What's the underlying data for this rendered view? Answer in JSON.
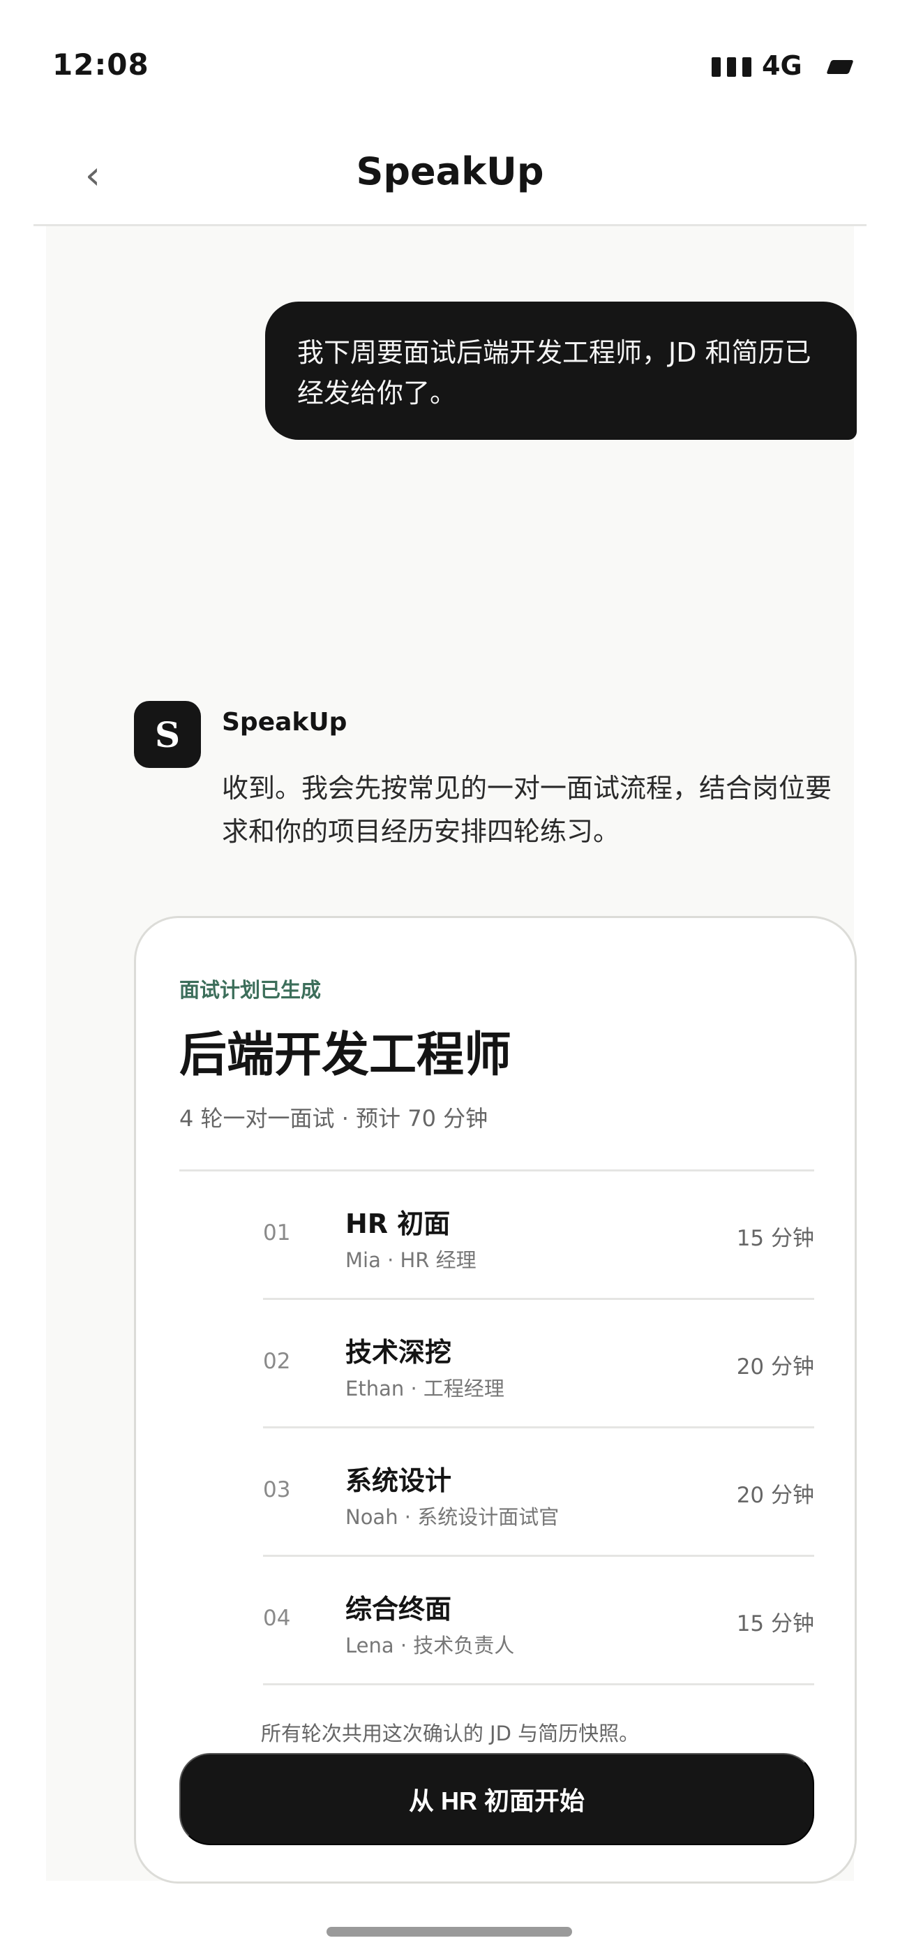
{
  "status_bar": {
    "time": "12:08",
    "network": "4G"
  },
  "nav": {
    "title": "SpeakUp",
    "back_icon": "‹"
  },
  "chat": {
    "user_message": "我下周要面试后端开发工程师，JD 和简历已经发给你了。",
    "bot": {
      "avatar_letter": "S",
      "name": "SpeakUp",
      "message": "收到。我会先按常见的一对一面试流程，结合岗位要求和你的项目经历安排四轮练习。"
    }
  },
  "plan": {
    "status": "面试计划已生成",
    "title": "后端开发工程师",
    "summary": "4 轮一对一面试 · 预计 70 分钟",
    "rounds": [
      {
        "num": "01",
        "name": "HR 初面",
        "meta": "Mia · HR 经理",
        "duration": "15 分钟"
      },
      {
        "num": "02",
        "name": "技术深挖",
        "meta": "Ethan · 工程经理",
        "duration": "20 分钟"
      },
      {
        "num": "03",
        "name": "系统设计",
        "meta": "Noah · 系统设计面试官",
        "duration": "20 分钟"
      },
      {
        "num": "04",
        "name": "综合终面",
        "meta": "Lena · 技术负责人",
        "duration": "15 分钟"
      }
    ],
    "start_button": "从 HR 初面开始"
  },
  "footer_note": "所有轮次共用这次确认的 JD 与简历快照。",
  "colors": {
    "accent_dark": "#151515",
    "status_green": "#3c6e5a",
    "chat_background": "#f9f9f7"
  }
}
